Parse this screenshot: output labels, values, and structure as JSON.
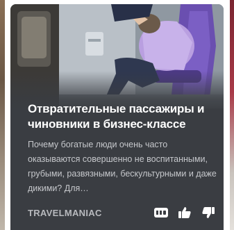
{
  "card": {
    "title": "Отвратительные пассажиры и чиновники в бизнес-классе",
    "snippet": "Почему богатые люди очень часто оказываются совершенно не воспитанными, грубыми, развязными, бескультурными и даже дикими? Для…",
    "channel": "TRAVELMANIAC",
    "image_description_icon": "airplane-cabin-photo",
    "actions": [
      {
        "icon": "more-icon",
        "semantic": "more"
      },
      {
        "icon": "like-icon",
        "semantic": "like"
      },
      {
        "icon": "dislike-icon",
        "semantic": "dislike"
      }
    ]
  },
  "colors": {
    "card_background": "#3a3d42",
    "title_text": "#ffffff",
    "snippet_text": "#c6c8cc",
    "channel_text": "#b8babe",
    "seat_purple": "#6a4fb0"
  }
}
